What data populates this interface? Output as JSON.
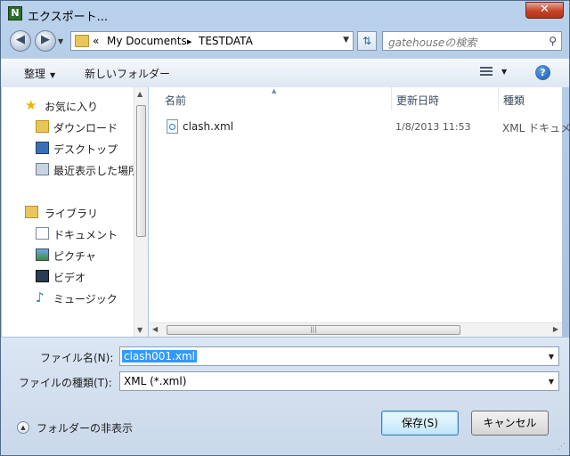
{
  "window": {
    "title": "エクスポート...",
    "close_label": "✕",
    "app_icon_letter": "N"
  },
  "nav": {
    "back_icon": "◀",
    "forward_icon": "▶",
    "address": {
      "overflow": "«",
      "crumbs": [
        "My Documents",
        "TESTDATA"
      ],
      "separator": "▶"
    },
    "search_placeholder": "gatehouseの検索"
  },
  "toolbar": {
    "organize_label": "整理",
    "new_folder_label": "新しいフォルダー"
  },
  "sidebar": {
    "items": [
      {
        "label": "お気に入り",
        "icon": "star-icon"
      },
      {
        "label": "ダウンロード",
        "icon": "downloads-folder-icon"
      },
      {
        "label": "デスクトップ",
        "icon": "desktop-icon"
      },
      {
        "label": "最近表示した場所",
        "icon": "recent-places-icon"
      },
      {
        "label": "ライブラリ",
        "icon": "libraries-icon"
      },
      {
        "label": "ドキュメント",
        "icon": "documents-icon"
      },
      {
        "label": "ピクチャ",
        "icon": "pictures-icon"
      },
      {
        "label": "ビデオ",
        "icon": "videos-icon"
      },
      {
        "label": "ミュージック",
        "icon": "music-icon"
      }
    ]
  },
  "file_list": {
    "columns": [
      "名前",
      "更新日時",
      "種類"
    ],
    "rows": [
      {
        "name": "clash.xml",
        "modified": "1/8/2013 11:53",
        "type": "XML ドキュメント"
      }
    ]
  },
  "form": {
    "filename_label": "ファイル名(N):",
    "filename_value": "clash001.xml",
    "filetype_label": "ファイルの種類(T):",
    "filetype_value": "XML (*.xml)"
  },
  "buttons": {
    "save": "保存(S)",
    "cancel": "キャンセル",
    "hide_folders": "フォルダーの非表示"
  },
  "colors": {
    "selection": "#3399ff",
    "window_frame": "#b9d1ea"
  }
}
